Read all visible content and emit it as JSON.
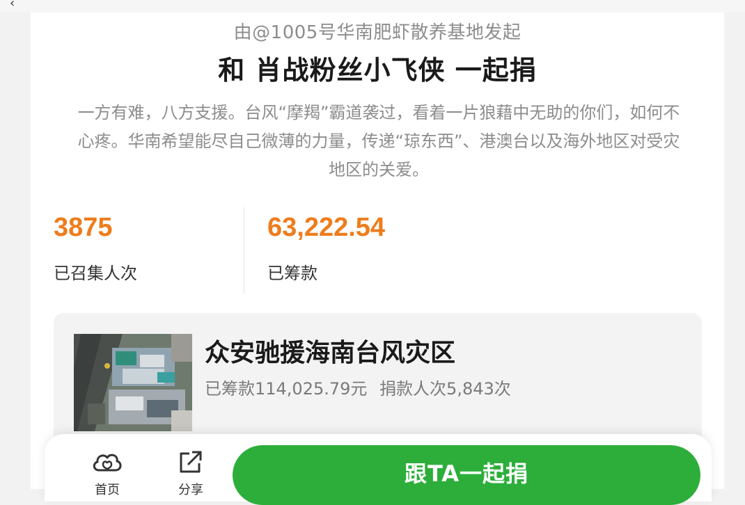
{
  "header": {
    "initiator": "由@1005号华南肥虾散养基地发起",
    "headline": "和 肖战粉丝小飞侠 一起捐",
    "description": "一方有难，八方支援。台风“摩羯”霸道袭过，看着一片狼藉中无助的你们，如何不心疼。华南希望能尽自己微薄的力量，传递“琼东西”、港澳台以及海外地区对受灾地区的关爱。"
  },
  "stats": {
    "participants_value": "3875",
    "participants_label": "已召集人次",
    "raised_value": "63,222.54",
    "raised_label": "已筹款"
  },
  "project": {
    "title": "众安驰援海南台风灾区",
    "raised": "已筹款114,025.79元",
    "donors": "捐款人次5,843次"
  },
  "bottom_bar": {
    "home_label": "首页",
    "share_label": "分享",
    "cta_label": "跟TA一起捐"
  },
  "colors": {
    "accent_orange": "#ee7c1c",
    "cta_green": "#2dae3b"
  }
}
